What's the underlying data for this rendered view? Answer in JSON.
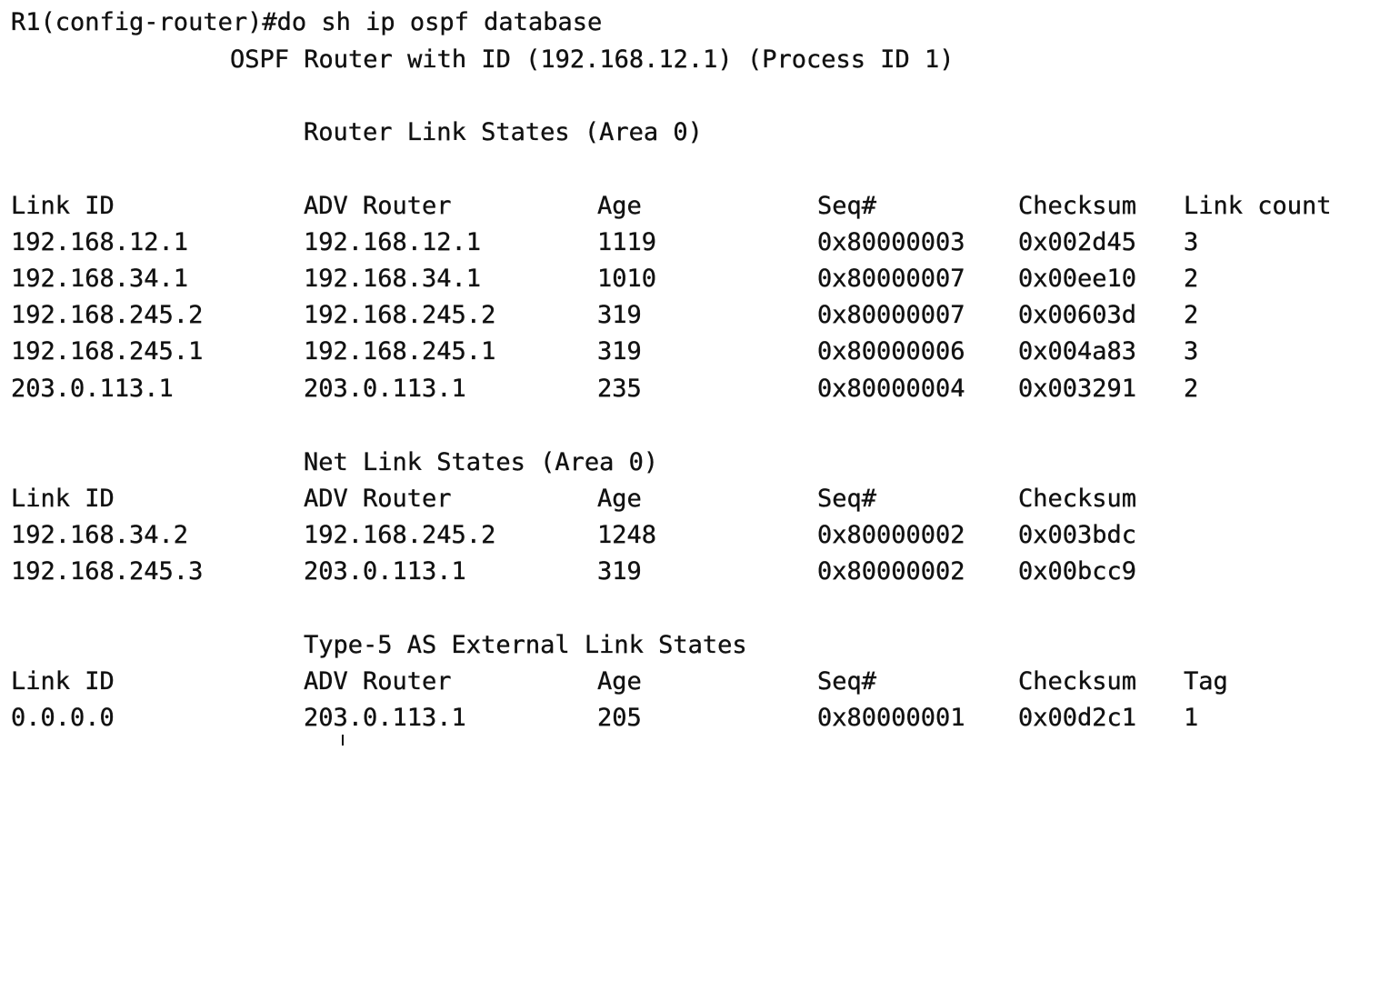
{
  "prompt": "R1(config-router)#do sh ip ospf database",
  "header": "OSPF Router with ID (192.168.12.1) (Process ID 1)",
  "router_section": {
    "title": "Router Link States (Area 0)",
    "columns": [
      "Link ID",
      "ADV Router",
      "Age",
      "Seq#",
      "Checksum",
      "Link count"
    ],
    "rows": [
      [
        "192.168.12.1",
        "192.168.12.1",
        "1119",
        "0x80000003",
        "0x002d45",
        "3"
      ],
      [
        "192.168.34.1",
        "192.168.34.1",
        "1010",
        "0x80000007",
        "0x00ee10",
        "2"
      ],
      [
        "192.168.245.2",
        "192.168.245.2",
        "319",
        "0x80000007",
        "0x00603d",
        "2"
      ],
      [
        "192.168.245.1",
        "192.168.245.1",
        "319",
        "0x80000006",
        "0x004a83",
        "3"
      ],
      [
        "203.0.113.1",
        "203.0.113.1",
        "235",
        "0x80000004",
        "0x003291",
        "2"
      ]
    ]
  },
  "net_section": {
    "title": "Net Link States (Area 0)",
    "columns": [
      "Link ID",
      "ADV Router",
      "Age",
      "Seq#",
      "Checksum"
    ],
    "rows": [
      [
        "192.168.34.2",
        "192.168.245.2",
        "1248",
        "0x80000002",
        "0x003bdc"
      ],
      [
        "192.168.245.3",
        "203.0.113.1",
        "319",
        "0x80000002",
        "0x00bcc9"
      ]
    ]
  },
  "external_section": {
    "title": "Type-5 AS External Link States",
    "columns": [
      "Link ID",
      "ADV Router",
      "Age",
      "Seq#",
      "Checksum",
      "Tag"
    ],
    "rows": [
      [
        "0.0.0.0",
        "203.0.113.1",
        "205",
        "0x80000001",
        "0x00d2c1",
        "1"
      ]
    ]
  }
}
